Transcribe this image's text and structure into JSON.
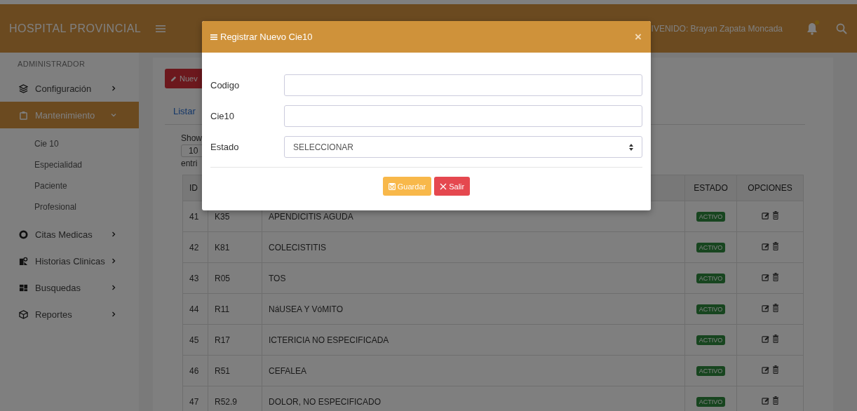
{
  "topbar": {
    "brand": "HOSPITAL PROVINCIAL",
    "welcome": "IVENIDO: Brayan Zapata Moncada",
    "has_notification": true
  },
  "sidebar": {
    "section": "ADMINISTRADOR",
    "items": [
      {
        "label": "Configuración",
        "selected": false,
        "expanded": false
      },
      {
        "label": "Mantenimiento",
        "selected": true,
        "expanded": true,
        "children": [
          {
            "label": "Cie 10"
          },
          {
            "label": "Especialidad"
          },
          {
            "label": "Paciente"
          },
          {
            "label": "Profesional"
          }
        ]
      },
      {
        "label": "Citas Medicas",
        "selected": false,
        "expanded": false
      },
      {
        "label": "Historias Clinicas",
        "selected": false,
        "expanded": false
      },
      {
        "label": "Busquedas",
        "selected": false,
        "expanded": false
      },
      {
        "label": "Reportes",
        "selected": false,
        "expanded": false
      }
    ]
  },
  "content": {
    "new_button": "Nuev",
    "tab": "Listar",
    "show_label": "Show",
    "page_size": "10",
    "entries_label": "entri",
    "table": {
      "columns": [
        "ID",
        "ESTADO",
        "OPCIONES"
      ],
      "rows": [
        {
          "id": "41",
          "code": "K35",
          "description": "APENDICITIS AGUDA",
          "status": "ACTIVO"
        },
        {
          "id": "42",
          "code": "K81",
          "description": "COLECISTITIS",
          "status": "ACTIVO"
        },
        {
          "id": "43",
          "code": "R05",
          "description": "TOS",
          "status": "ACTIVO"
        },
        {
          "id": "44",
          "code": "R11",
          "description": "NáUSEA Y VóMITO",
          "status": "ACTIVO"
        },
        {
          "id": "45",
          "code": "R17",
          "description": "ICTERICIA NO ESPECIFICADA",
          "status": "ACTIVO"
        },
        {
          "id": "46",
          "code": "R51",
          "description": "CEFALEA",
          "status": "ACTIVO"
        },
        {
          "id": "47",
          "code": "R52.9",
          "description": "DOLOR, NO ESPECIFICADO",
          "status": "ACTIVO"
        }
      ]
    }
  },
  "modal": {
    "title": "Registrar Nuevo Cie10",
    "close": "×",
    "fields": [
      {
        "label": "Codigo",
        "kind": "text"
      },
      {
        "label": "Cie10",
        "kind": "text"
      },
      {
        "label": "Estado",
        "kind": "select",
        "value": "SELECCIONAR"
      }
    ],
    "buttons": [
      {
        "label": "Guardar",
        "kind": "save"
      },
      {
        "label": "Salir",
        "kind": "exit"
      }
    ]
  }
}
